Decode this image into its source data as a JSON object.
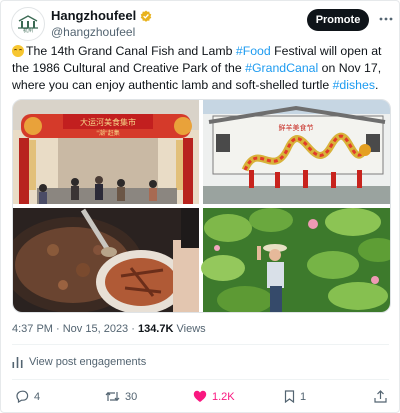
{
  "account": {
    "display_name": "Hangzhoufeel",
    "handle": "@hangzhoufeel",
    "logo_text": "杭州"
  },
  "header": {
    "promote_label": "Promote"
  },
  "post": {
    "text_a": "The 14th Grand Canal Fish and Lamb ",
    "hashtag_food": "#Food",
    "text_b": " Festival will open at the 1986 Cultural and Creative Park of the ",
    "hashtag_canal": "#GrandCanal",
    "text_c": " on Nov 17, where you can enjoy authentic lamb and soft-shelled turtle ",
    "hashtag_dishes": "#dishes",
    "text_d": "."
  },
  "media": {
    "banner_text": "大运河美食集市",
    "banner_sub": "\"潮\"赶集",
    "stage_text": "鲜羊美食节"
  },
  "meta": {
    "timestamp": "4:37 PM · Nov 15, 2023 · ",
    "views_count": "134.7K",
    "views_label": " Views"
  },
  "engagements_label": "View post engagements",
  "actions": {
    "replies": "4",
    "reposts": "30",
    "likes": "1.2K",
    "bookmarks": "1"
  },
  "colors": {
    "link": "#1d9bf0",
    "like": "#f91880",
    "button": "#0f1419",
    "badge": "#e8b21c"
  }
}
